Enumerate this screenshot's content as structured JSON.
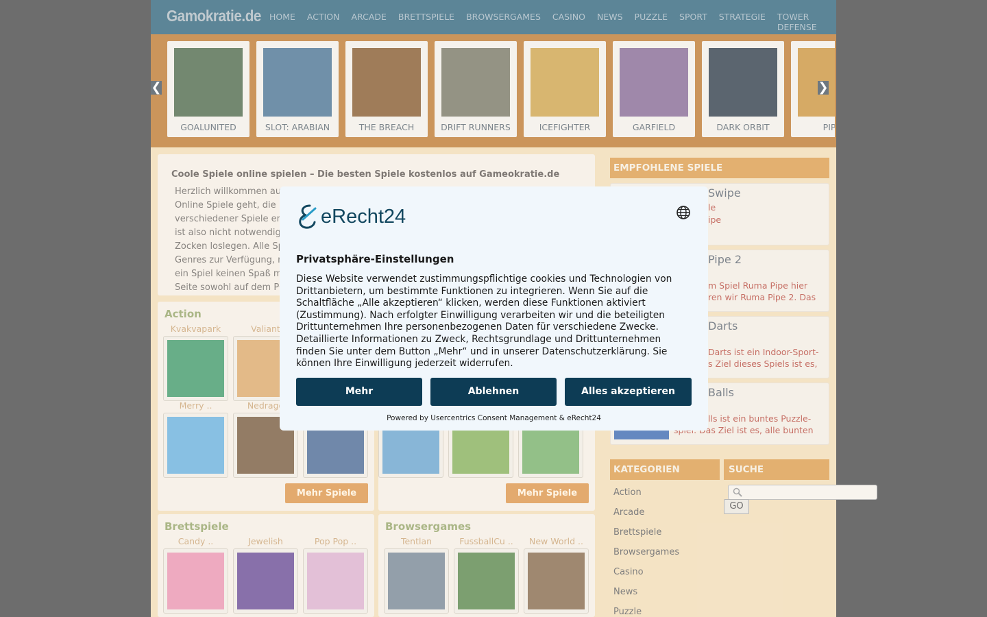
{
  "site": {
    "logo": "Gamokratie.de"
  },
  "nav": [
    "HOME",
    "ACTION",
    "ARCADE",
    "BRETTSPIELE",
    "BROWSERGAMES",
    "CASINO",
    "NEWS",
    "PUZZLE",
    "SPORT",
    "STRATEGIE",
    "TOWER DEFENSE"
  ],
  "carousel": {
    "prev_icon": "chevron-left-icon",
    "next_icon": "chevron-right-icon",
    "prev_glyph": "❮",
    "next_glyph": "❯",
    "items": [
      {
        "title": "GOALUNITED",
        "color": "#3d5a3a"
      },
      {
        "title": "SLOT: ARABIAN",
        "color": "#3a6688"
      },
      {
        "title": "THE BREACH",
        "color": "#7a4a1a"
      },
      {
        "title": "DRIFT RUNNERS",
        "color": "#6b6a55"
      },
      {
        "title": "ICEFIGHTER",
        "color": "#c99a3a"
      },
      {
        "title": "GARFIELD",
        "color": "#7a5a8a"
      },
      {
        "title": "DARK ORBIT",
        "color": "#1d2a38"
      },
      {
        "title": "PIPE",
        "color": "#c78a2a"
      }
    ]
  },
  "intro": {
    "title": "Coole Spiele online spielen – Die besten Spiele kostenlos auf Gameokratie.de",
    "lines": [
      "Herzlich willkommen auf Gameokratie.de – hier bist Du genau richtig, wenn es um tolle",
      "Online Spiele geht, die D",
      "verschiedener Spiele erw",
      "ist also nicht notwendig.",
      "Zocken loslegen. Alle Spi",
      "Genres zur Verfügung, m",
      "ein Spiel keinen Spaß ma",
      "Seite sowohl auf dem PC"
    ]
  },
  "sections": {
    "action": {
      "title": "Action",
      "names": [
        "Kvakvapark",
        "Valiant",
        "",
        "Merry ..",
        "Nedrago",
        ""
      ],
      "colors": [
        "#2f8f5a",
        "#d9a05a",
        "#888",
        "#5aa8d8",
        "#6a4a2a",
        "#3a5a8a"
      ],
      "more": "Mehr Spiele"
    },
    "second": {
      "colors": [
        "#5a9ac8",
        "#7aa84a",
        "#6aa85a"
      ],
      "more": "Mehr Spiele"
    },
    "brettspiele": {
      "title": "Brettspiele",
      "names": [
        "Candy ..",
        "Jewelish",
        "Pop Pop .."
      ],
      "colors": [
        "#e88aa8",
        "#5a3a8a",
        "#d8a8c8"
      ]
    },
    "browsergames": {
      "title": "Browsergames",
      "names": [
        "Tentlan",
        "FussballCu ..",
        "New World .."
      ],
      "colors": [
        "#6a7a8a",
        "#4a7a3a",
        "#7a5a3a"
      ]
    }
  },
  "sidebar": {
    "recommended_title": "EMPFOHLENE SPIELE",
    "recommended": [
      {
        "title": "Swipe",
        "lines": [
          "le",
          "ipe"
        ]
      },
      {
        "title": "Pipe 2",
        "lines": [
          "m Spiel Ruma Pipe hier",
          "ren wir Ruma Pipe 2. Das"
        ]
      },
      {
        "title": "Darts",
        "lines": [
          "Darts ist ein Indoor-Sport-",
          "s Ziel dieses Spiels ist es,"
        ]
      },
      {
        "title": "Balls",
        "lines": [
          "lls ist ein buntes Puzzle-",
          "spiel. Das Ziel ist es, alle bunten"
        ]
      }
    ],
    "categories_title": "KATEGORIEN",
    "categories": [
      "Action",
      "Arcade",
      "Brettspiele",
      "Browsergames",
      "Casino",
      "News",
      "Puzzle"
    ],
    "search_title": "SUCHE",
    "search_icon": "magnifier-icon",
    "search_button": "GO"
  },
  "consent": {
    "logo": "eRecht24",
    "language_icon": "globe-icon",
    "title": "Privatsphäre-Einstellungen",
    "text": "Diese Website verwendet zustimmungspflichtige cookies und Technologien von Drittanbietern, um bestimmte Funktionen zu integrieren. Wenn Sie auf die Schaltfläche „Alle akzeptieren“ klicken, werden diese Funktionen aktiviert (Zustimmung). Nach erfolgter Einwilligung verarbeiten wir und die beteiligten Drittunternehmen Ihre personenbezogenen Daten für verschiedene Zwecke. Detaillierte Informationen zu Zweck, Rechtsgrundlage und Drittunternehmen finden Sie unter dem Button „Mehr“ und in unserer Datenschutzerklärung. Sie können Ihre Einwilligung jederzeit widerrufen.",
    "buttons": {
      "more": "Mehr",
      "deny": "Ablehnen",
      "accept": "Alles akzeptieren"
    },
    "powered": "Powered by Usercentrics Consent Management & eRecht24"
  }
}
